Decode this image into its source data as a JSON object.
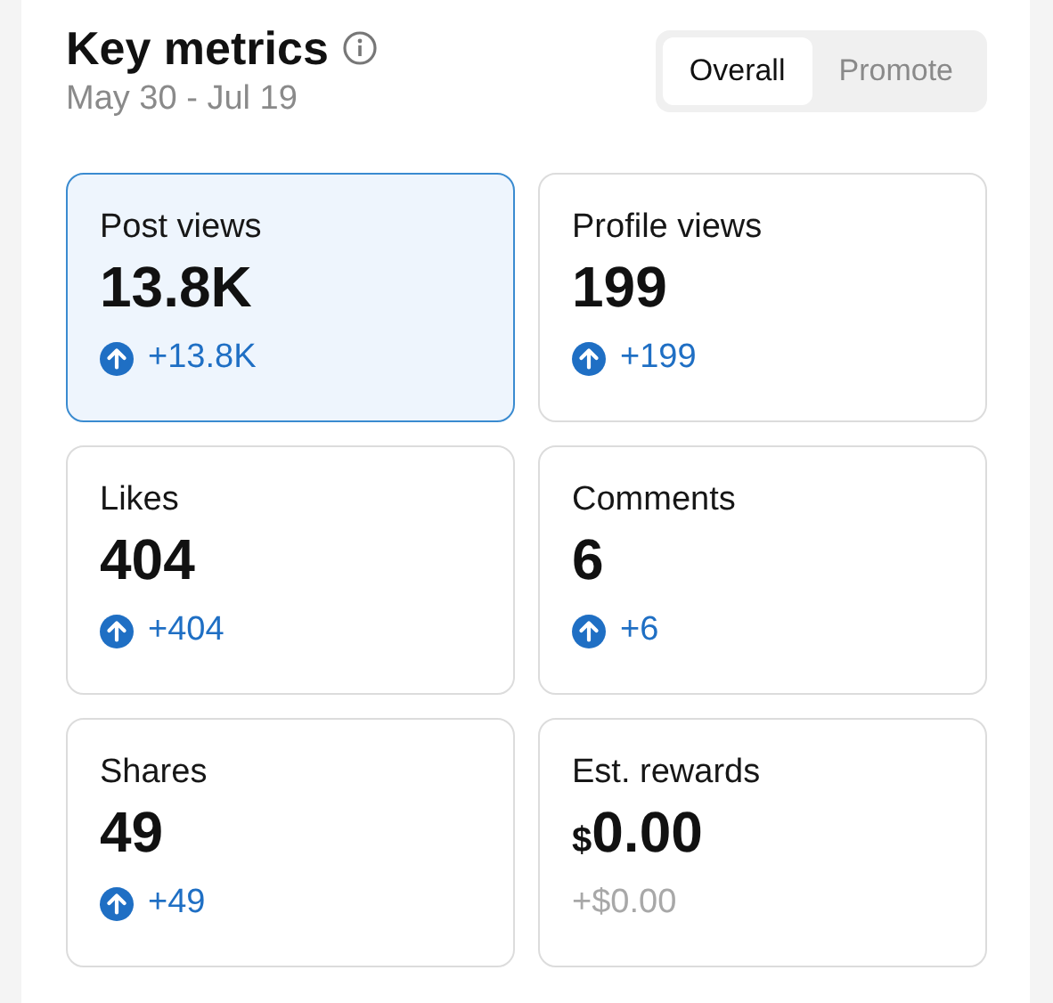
{
  "header": {
    "title": "Key metrics",
    "date_range": "May 30 - Jul 19"
  },
  "tabs": [
    {
      "label": "Overall",
      "selected": true
    },
    {
      "label": "Promote",
      "selected": false
    }
  ],
  "metrics": [
    {
      "label": "Post views",
      "value": "13.8K",
      "change": "+13.8K",
      "kind": "rising",
      "selected": true
    },
    {
      "label": "Profile views",
      "value": "199",
      "change": "+199",
      "kind": "rising",
      "selected": false
    },
    {
      "label": "Likes",
      "value": "404",
      "change": "+404",
      "kind": "rising",
      "selected": false
    },
    {
      "label": "Comments",
      "value": "6",
      "change": "+6",
      "kind": "rising",
      "selected": false
    },
    {
      "label": "Shares",
      "value": "49",
      "change": "+49",
      "kind": "rising",
      "selected": false
    },
    {
      "label": "Est. rewards",
      "currency": "$",
      "value": "0.00",
      "change": "+$0.00",
      "kind": "flat",
      "selected": false
    }
  ]
}
